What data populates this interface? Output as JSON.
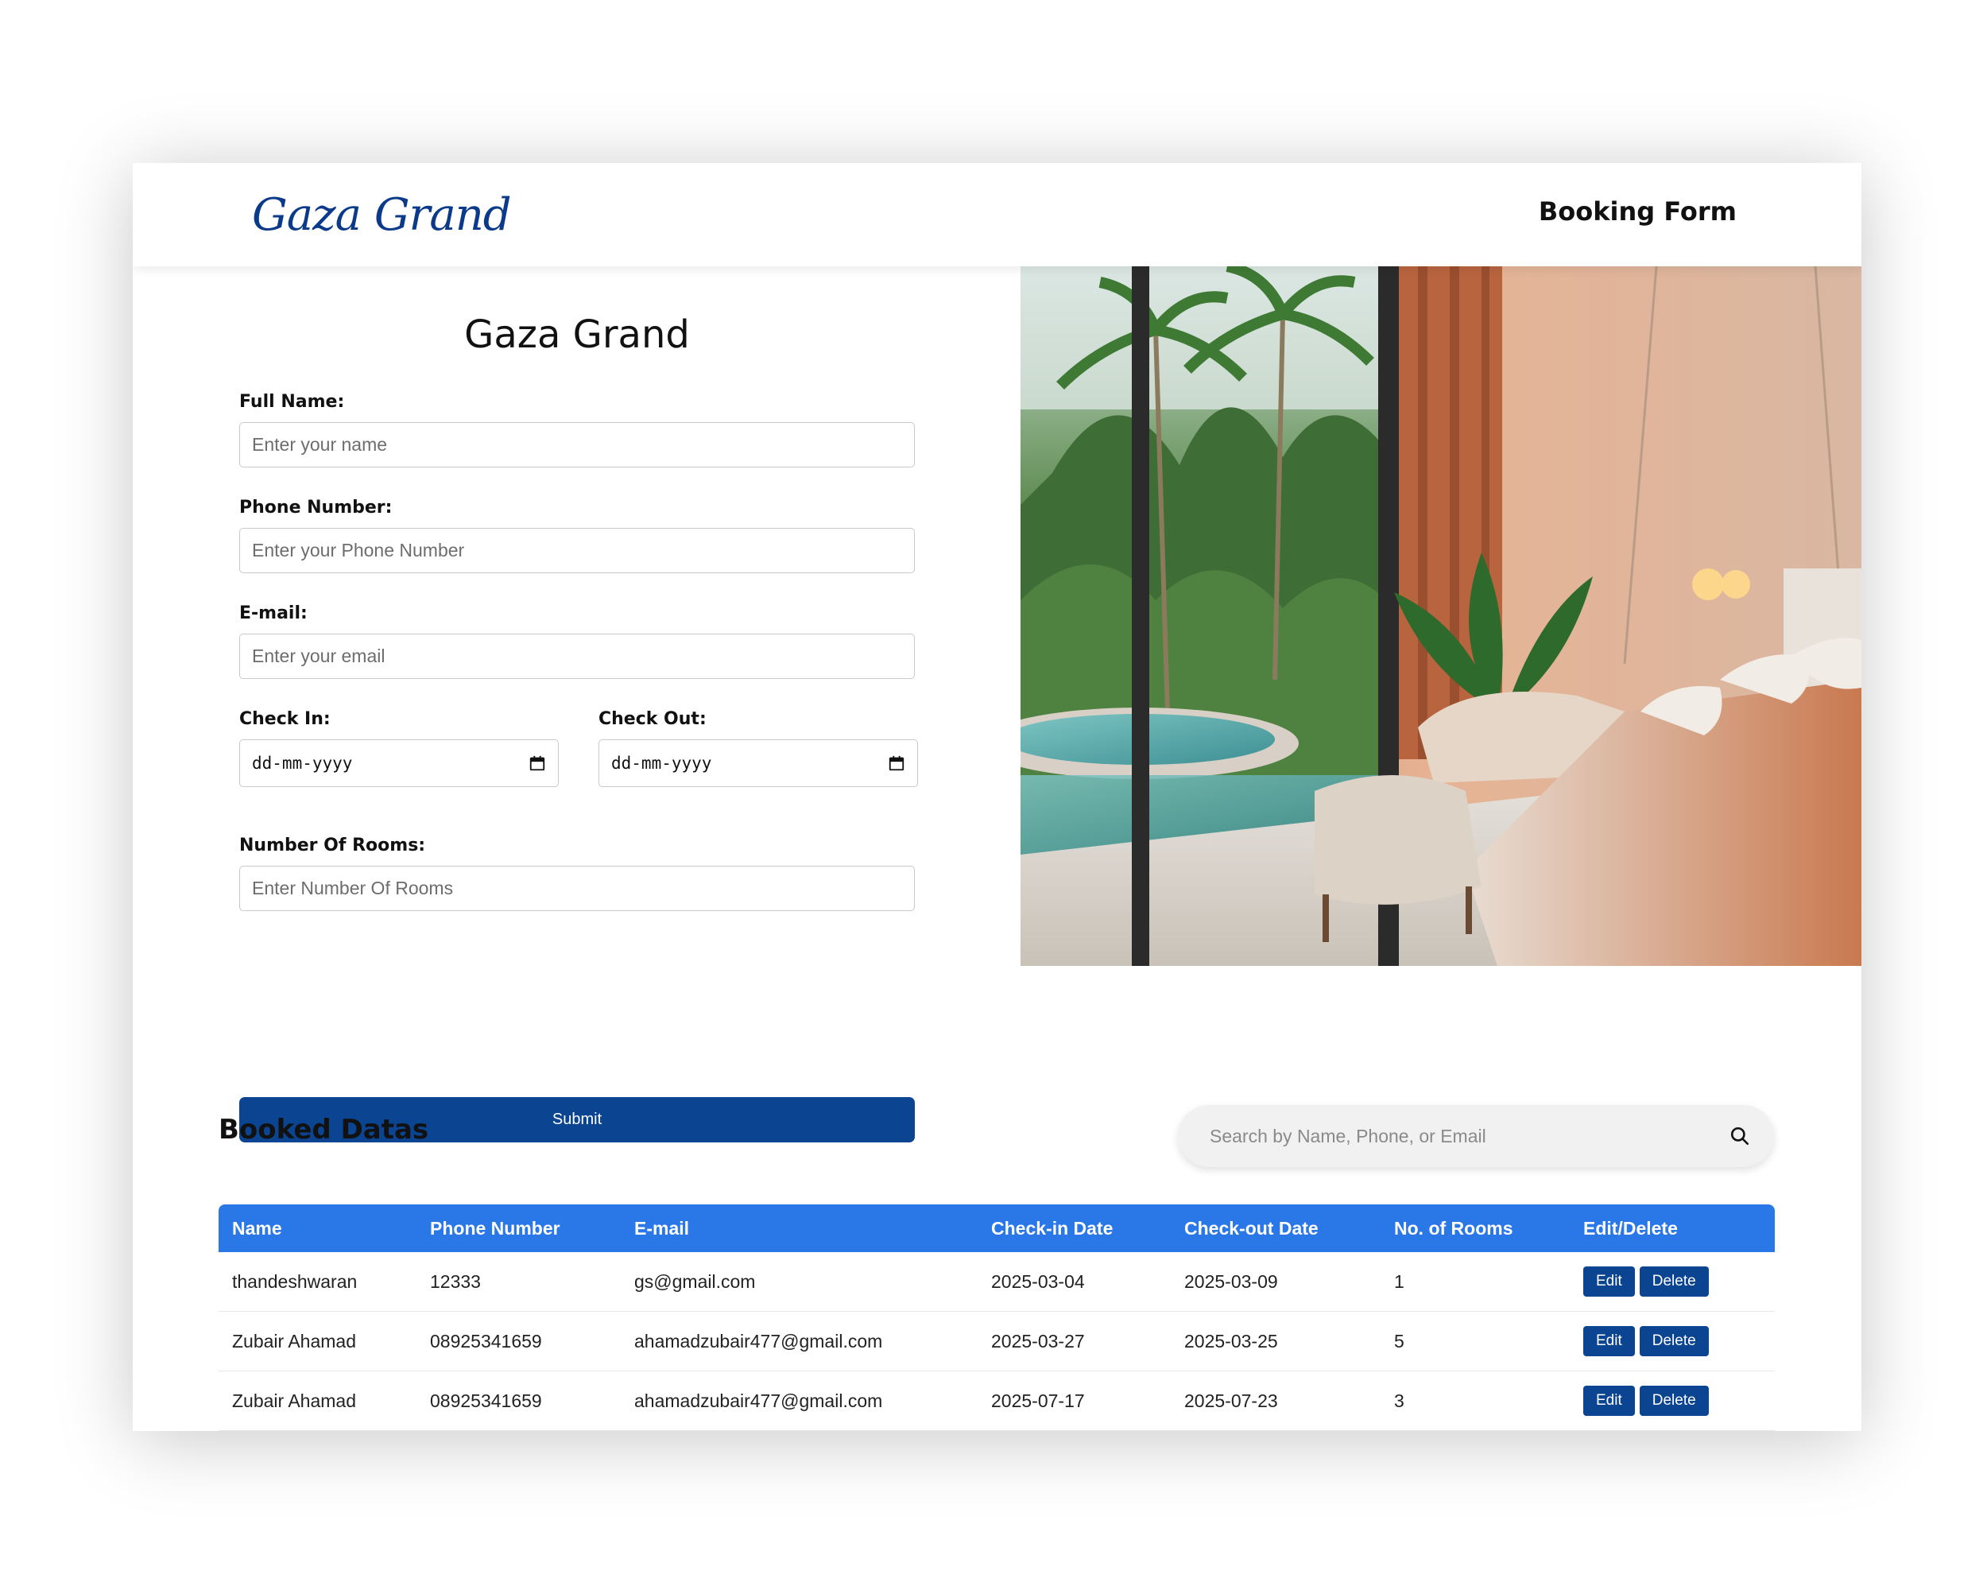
{
  "header": {
    "logo": "Gaza Grand",
    "nav_link": "Booking Form"
  },
  "form": {
    "title": "Gaza Grand",
    "full_name": {
      "label": "Full Name:",
      "placeholder": "Enter your name"
    },
    "phone": {
      "label": "Phone Number:",
      "placeholder": "Enter your Phone Number"
    },
    "email": {
      "label": "E-mail:",
      "placeholder": "Enter your email"
    },
    "check_in": {
      "label": "Check In:",
      "value": "dd-mm-yyyy"
    },
    "check_out": {
      "label": "Check Out:",
      "value": "dd-mm-yyyy"
    },
    "rooms": {
      "label": "Number Of Rooms:",
      "placeholder": "Enter Number Of Rooms"
    },
    "submit_label": "Submit"
  },
  "booked": {
    "title": "Booked Datas",
    "search_placeholder": "Search by Name, Phone, or Email",
    "columns": [
      "Name",
      "Phone Number",
      "E-mail",
      "Check-in Date",
      "Check-out Date",
      "No. of Rooms",
      "Edit/Delete"
    ],
    "rows": [
      [
        "thandeshwaran",
        "12333",
        "gs@gmail.com",
        "2025-03-04",
        "2025-03-09",
        "1"
      ],
      [
        "Zubair Ahamad",
        "08925341659",
        "ahamadzubair477@gmail.com",
        "2025-03-27",
        "2025-03-25",
        "5"
      ],
      [
        "Zubair Ahamad",
        "08925341659",
        "ahamadzubair477@gmail.com",
        "2025-07-17",
        "2025-07-23",
        "3"
      ]
    ],
    "edit_label": "Edit",
    "delete_label": "Delete"
  },
  "icons": {
    "calendar": "calendar-icon",
    "search": "search-icon"
  },
  "colors": {
    "brand_blue": "#0b4592",
    "table_header": "#2a77e8",
    "logo": "#0b3a8a"
  }
}
